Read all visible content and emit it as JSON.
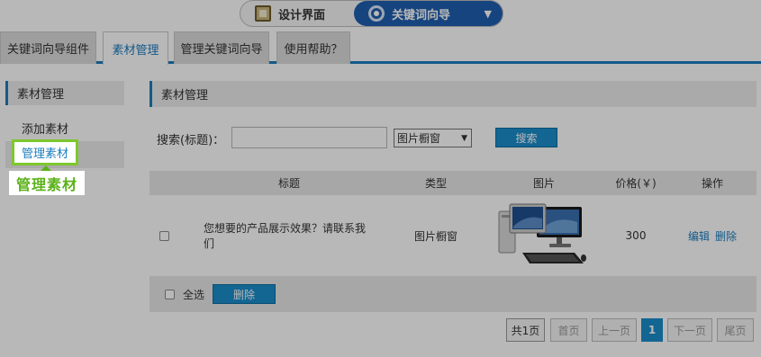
{
  "mode_switch": {
    "design_label": "设计界面",
    "wizard_label": "关键词向导"
  },
  "tabs": [
    {
      "label": "关键词向导组件"
    },
    {
      "label": "素材管理"
    },
    {
      "label": "管理关键词向导"
    },
    {
      "label": "使用帮助？"
    }
  ],
  "sidebar": {
    "title": "素材管理",
    "items": [
      {
        "label": "添加素材"
      },
      {
        "label": "管理素材"
      }
    ]
  },
  "main": {
    "title": "素材管理",
    "search": {
      "label": "搜索(标题)：",
      "value": "",
      "type_selected": "图片橱窗",
      "button_label": "搜索"
    },
    "table": {
      "headers": [
        "标题",
        "类型",
        "图片",
        "价格(￥)",
        "操作"
      ],
      "rows": [
        {
          "title": "您想要的产品展示效果？请联系我们",
          "type": "图片橱窗",
          "image": "desktop-computer-product-image",
          "price": "300",
          "edit": "编辑",
          "delete": "删除"
        }
      ]
    },
    "footer": {
      "select_all": "全选",
      "delete_label": "删除"
    },
    "pager": {
      "total": "共1页",
      "first": "首页",
      "prev": "上一页",
      "current": "1",
      "next": "下一页",
      "last": "尾页"
    }
  },
  "callout": {
    "highlight_label": "管理素材",
    "tip_label": "管理素材"
  },
  "colors": {
    "accent": "#1b7dbf",
    "button": "#1b8dcb",
    "highlight_border": "#7dc72e",
    "tip_text": "#5cb21a"
  }
}
